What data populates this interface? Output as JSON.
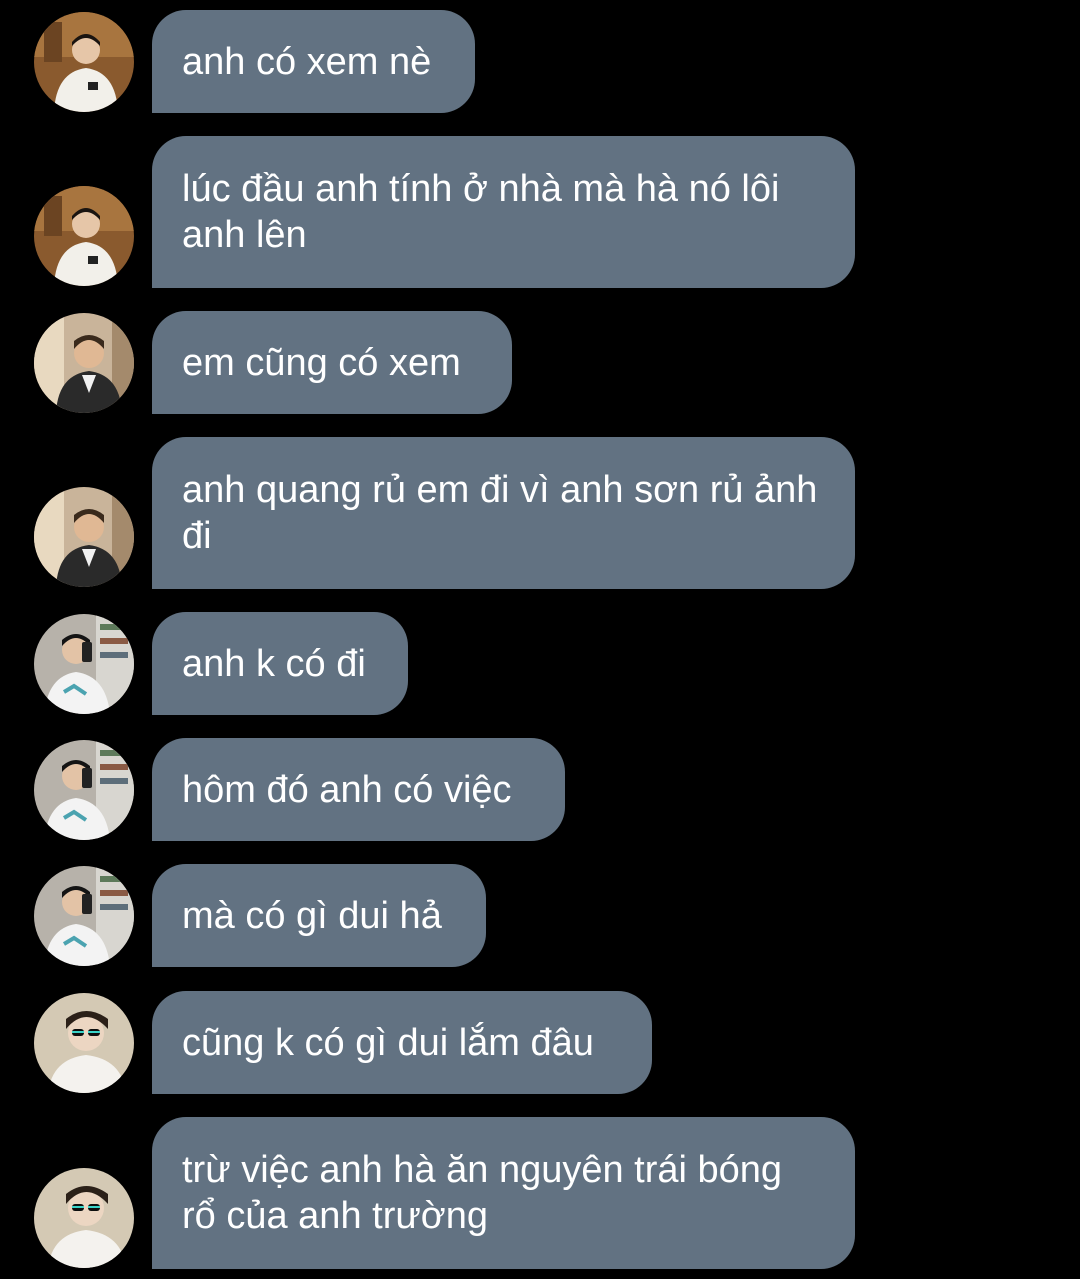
{
  "messages": [
    {
      "avatar": "user-a-avatar",
      "text": "anh có xem nè"
    },
    {
      "avatar": "user-a-avatar",
      "text": "lúc đầu anh tính ở nhà mà hà nó lôi anh lên"
    },
    {
      "avatar": "user-b-avatar",
      "text": "em cũng có xem"
    },
    {
      "avatar": "user-b-avatar",
      "text": "anh quang rủ em đi vì anh sơn rủ ảnh đi"
    },
    {
      "avatar": "user-c-avatar",
      "text": "anh k có đi"
    },
    {
      "avatar": "user-c-avatar",
      "text": "hôm đó anh có việc"
    },
    {
      "avatar": "user-c-avatar",
      "text": "mà có gì dui hả"
    },
    {
      "avatar": "user-d-avatar",
      "text": "cũng k có gì dui lắm đâu"
    },
    {
      "avatar": "user-d-avatar",
      "text": "trừ việc anh hà ăn nguyên trái bóng rổ của anh trường"
    }
  ],
  "colors": {
    "background": "#000000",
    "bubble": "#627282",
    "text": "#ffffff"
  }
}
